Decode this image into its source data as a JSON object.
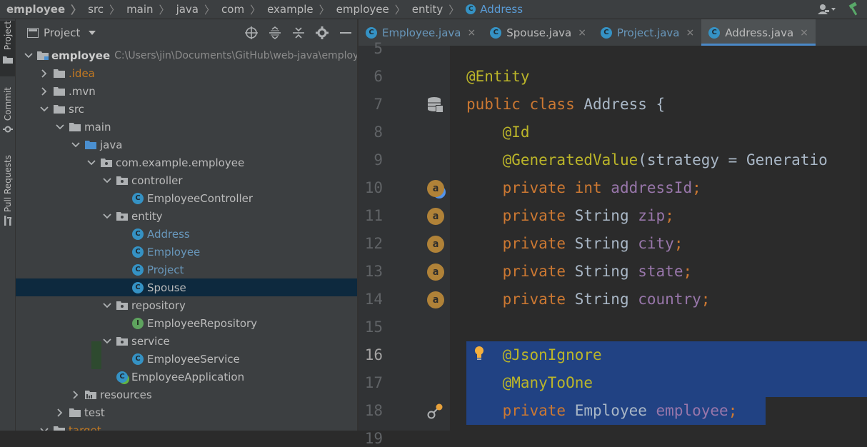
{
  "navbar": {
    "crumbs": [
      "employee",
      "src",
      "main",
      "java",
      "com",
      "example",
      "employee",
      "entity"
    ],
    "class_crumb": "Address",
    "class_badge": "C"
  },
  "toolstrip": {
    "project": "Project",
    "commit": "Commit",
    "pull_requests": "Pull Requests"
  },
  "project_panel": {
    "title": "Project",
    "tree": [
      {
        "label": "employee",
        "path": "C:\\Users\\jin\\Documents\\GitHub\\web-java\\employee",
        "icon": "module-folder-icon"
      },
      {
        "label": ".idea",
        "icon": "folder-icon"
      },
      {
        "label": ".mvn",
        "icon": "folder-icon"
      },
      {
        "label": "src",
        "icon": "folder-icon"
      },
      {
        "label": "main",
        "icon": "folder-icon"
      },
      {
        "label": "java",
        "icon": "source-folder-icon"
      },
      {
        "label": "com.example.employee",
        "icon": "package-icon"
      },
      {
        "label": "controller",
        "icon": "package-icon"
      },
      {
        "label": "EmployeeController",
        "icon": "class-icon",
        "badge": "C"
      },
      {
        "label": "entity",
        "icon": "package-icon"
      },
      {
        "label": "Address",
        "icon": "class-icon",
        "badge": "C"
      },
      {
        "label": "Employee",
        "icon": "class-icon",
        "badge": "C"
      },
      {
        "label": "Project",
        "icon": "class-icon",
        "badge": "C"
      },
      {
        "label": "Spouse",
        "icon": "class-icon",
        "badge": "C"
      },
      {
        "label": "repository",
        "icon": "package-icon"
      },
      {
        "label": "EmployeeRepository",
        "icon": "interface-icon",
        "badge": "I"
      },
      {
        "label": "service",
        "icon": "package-icon"
      },
      {
        "label": "EmployeeService",
        "icon": "class-icon",
        "badge": "C"
      },
      {
        "label": "EmployeeApplication",
        "icon": "spring-app-icon",
        "badge": "C"
      },
      {
        "label": "resources",
        "icon": "resources-folder-icon"
      },
      {
        "label": "test",
        "icon": "folder-icon"
      },
      {
        "label": "target",
        "icon": "folder-icon"
      }
    ]
  },
  "tabs": [
    {
      "label": "Employee.java",
      "close": "×",
      "badge": "C"
    },
    {
      "label": "Spouse.java",
      "close": "×",
      "badge": "C"
    },
    {
      "label": "Project.java",
      "close": "×",
      "badge": "C"
    },
    {
      "label": "Address.java",
      "close": "×",
      "badge": "C"
    }
  ],
  "editor": {
    "line_numbers": [
      "5",
      "6",
      "7",
      "8",
      "9",
      "10",
      "11",
      "12",
      "13",
      "14",
      "15",
      "16",
      "17",
      "18",
      "19"
    ],
    "field_badge": "a",
    "lines": [
      [
        {
          "t": "ann",
          "v": "@Entity"
        }
      ],
      [
        {
          "t": "kw",
          "v": "public class "
        },
        {
          "t": "tx",
          "v": "Address {"
        }
      ],
      [
        {
          "t": "tx",
          "v": "    "
        },
        {
          "t": "ann",
          "v": "@Id"
        }
      ],
      [
        {
          "t": "tx",
          "v": "    "
        },
        {
          "t": "ann",
          "v": "@GeneratedValue"
        },
        {
          "t": "tx",
          "v": "(strategy = Generatio"
        }
      ],
      [
        {
          "t": "tx",
          "v": "    "
        },
        {
          "t": "kw",
          "v": "private int "
        },
        {
          "t": "fld",
          "v": "addressId"
        },
        {
          "t": "kw",
          "v": ";"
        }
      ],
      [
        {
          "t": "tx",
          "v": "    "
        },
        {
          "t": "kw",
          "v": "private "
        },
        {
          "t": "tx",
          "v": "String "
        },
        {
          "t": "fld",
          "v": "zip"
        },
        {
          "t": "kw",
          "v": ";"
        }
      ],
      [
        {
          "t": "tx",
          "v": "    "
        },
        {
          "t": "kw",
          "v": "private "
        },
        {
          "t": "tx",
          "v": "String "
        },
        {
          "t": "fld",
          "v": "city"
        },
        {
          "t": "kw",
          "v": ";"
        }
      ],
      [
        {
          "t": "tx",
          "v": "    "
        },
        {
          "t": "kw",
          "v": "private "
        },
        {
          "t": "tx",
          "v": "String "
        },
        {
          "t": "fld",
          "v": "state"
        },
        {
          "t": "kw",
          "v": ";"
        }
      ],
      [
        {
          "t": "tx",
          "v": "    "
        },
        {
          "t": "kw",
          "v": "private "
        },
        {
          "t": "tx",
          "v": "String "
        },
        {
          "t": "fld",
          "v": "country"
        },
        {
          "t": "kw",
          "v": ";"
        }
      ],
      [],
      [
        {
          "t": "tx",
          "v": "    "
        },
        {
          "t": "ann",
          "v": "@JsonIgnore"
        }
      ],
      [
        {
          "t": "tx",
          "v": "    "
        },
        {
          "t": "ann",
          "v": "@ManyToOne"
        }
      ],
      [
        {
          "t": "tx",
          "v": "    "
        },
        {
          "t": "kw",
          "v": "private "
        },
        {
          "t": "tx",
          "v": "Employee "
        },
        {
          "t": "fld",
          "v": "employee"
        },
        {
          "t": "kw",
          "v": ";"
        }
      ]
    ]
  },
  "colors": {
    "keyword": "#cc7832",
    "annotation": "#bbb529",
    "field": "#9876aa",
    "text": "#a9b7c6",
    "selection": "#214283",
    "accent": "#4a88c7"
  }
}
